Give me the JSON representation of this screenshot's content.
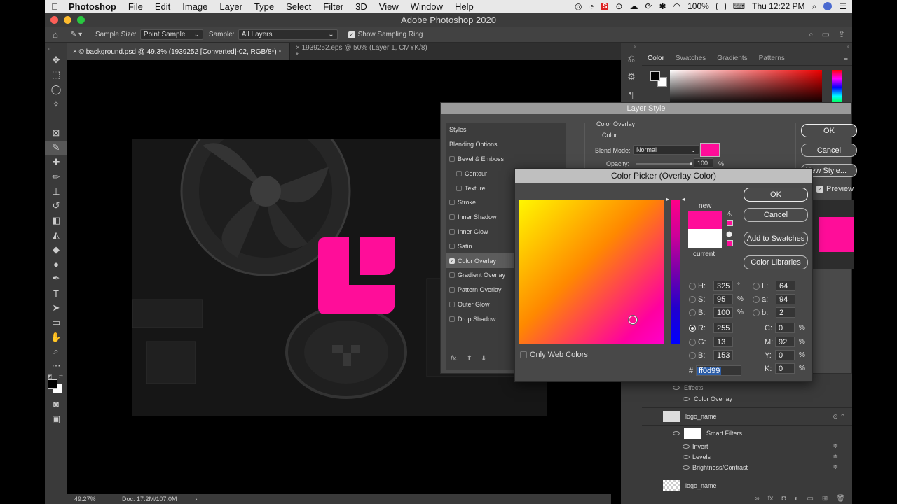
{
  "menubar": {
    "apple": "",
    "app": "Photoshop",
    "items": [
      "File",
      "Edit",
      "Image",
      "Layer",
      "Type",
      "Select",
      "Filter",
      "3D",
      "View",
      "Window",
      "Help"
    ],
    "battery": "100%",
    "clock": "Thu 12:22 PM"
  },
  "window": {
    "title": "Adobe Photoshop 2020"
  },
  "options": {
    "sample_size_label": "Sample Size:",
    "sample_size_value": "Point Sample",
    "sample_label": "Sample:",
    "sample_value": "All Layers",
    "sampling_ring_label": "Show Sampling Ring"
  },
  "tabs": [
    {
      "label": "×  © background.psd @ 49.3% (1939252 [Converted]-02, RGB/8*) *"
    },
    {
      "label": "×  1939252.eps @ 50% (Layer 1, CMYK/8) *"
    }
  ],
  "status": {
    "zoom": "49.27%",
    "doc": "Doc: 17.2M/107.0M",
    "arrow": "›"
  },
  "color_panel": {
    "tabs": [
      "Color",
      "Swatches",
      "Gradients",
      "Patterns"
    ]
  },
  "layer_style": {
    "title": "Layer Style",
    "styles_header": "Styles",
    "items": [
      {
        "label": "Blending Options",
        "checkbox": false,
        "checked": false,
        "indent": false
      },
      {
        "label": "Bevel & Emboss",
        "checkbox": true,
        "checked": false,
        "indent": false
      },
      {
        "label": "Contour",
        "checkbox": true,
        "checked": false,
        "indent": true
      },
      {
        "label": "Texture",
        "checkbox": true,
        "checked": false,
        "indent": true
      },
      {
        "label": "Stroke",
        "checkbox": true,
        "checked": false,
        "indent": false
      },
      {
        "label": "Inner Shadow",
        "checkbox": true,
        "checked": false,
        "indent": false
      },
      {
        "label": "Inner Glow",
        "checkbox": true,
        "checked": false,
        "indent": false
      },
      {
        "label": "Satin",
        "checkbox": true,
        "checked": false,
        "indent": false
      },
      {
        "label": "Color Overlay",
        "checkbox": true,
        "checked": true,
        "indent": false
      },
      {
        "label": "Gradient Overlay",
        "checkbox": true,
        "checked": false,
        "indent": false
      },
      {
        "label": "Pattern Overlay",
        "checkbox": true,
        "checked": false,
        "indent": false
      },
      {
        "label": "Outer Glow",
        "checkbox": true,
        "checked": false,
        "indent": false
      },
      {
        "label": "Drop Shadow",
        "checkbox": true,
        "checked": false,
        "indent": false
      }
    ],
    "section_title": "Color Overlay",
    "section_sub": "Color",
    "blend_mode_label": "Blend Mode:",
    "blend_mode_value": "Normal",
    "opacity_label": "Opacity:",
    "opacity_value": "100",
    "opacity_unit": "%",
    "fx": "fx.",
    "ok": "OK",
    "cancel": "Cancel",
    "new_style": "New Style...",
    "preview": "Preview",
    "overlay_color": "#ff0d99"
  },
  "color_picker": {
    "title": "Color Picker (Overlay Color)",
    "new_label": "new",
    "current_label": "current",
    "ok": "OK",
    "cancel": "Cancel",
    "add_swatches": "Add to Swatches",
    "libraries": "Color Libraries",
    "only_web": "Only Web Colors",
    "hex_label": "#",
    "hex": "ff0d99",
    "new_color": "#ff0d99",
    "current_color": "#ffffff",
    "h": {
      "label": "H:",
      "value": "325",
      "unit": "°"
    },
    "s": {
      "label": "S:",
      "value": "95",
      "unit": "%"
    },
    "b": {
      "label": "B:",
      "value": "100",
      "unit": "%"
    },
    "r": {
      "label": "R:",
      "value": "255"
    },
    "g": {
      "label": "G:",
      "value": "13"
    },
    "bb": {
      "label": "B:",
      "value": "153"
    },
    "l": {
      "label": "L:",
      "value": "64"
    },
    "a": {
      "label": "a:",
      "value": "94"
    },
    "b2": {
      "label": "b:",
      "value": "2"
    },
    "c": {
      "label": "C:",
      "value": "0",
      "unit": "%"
    },
    "m": {
      "label": "M:",
      "value": "92",
      "unit": "%"
    },
    "y": {
      "label": "Y:",
      "value": "0",
      "unit": "%"
    },
    "k": {
      "label": "K:",
      "value": "0",
      "unit": "%"
    }
  },
  "layers": {
    "effects": "Effects",
    "color_overlay": "Color Overlay",
    "layer1": "logo_name",
    "smart_filters": "Smart Filters",
    "invert": "Invert",
    "levels": "Levels",
    "brightness": "Brightness/Contrast",
    "layer2": "logo_name"
  },
  "logo_color": "#ff0d99"
}
